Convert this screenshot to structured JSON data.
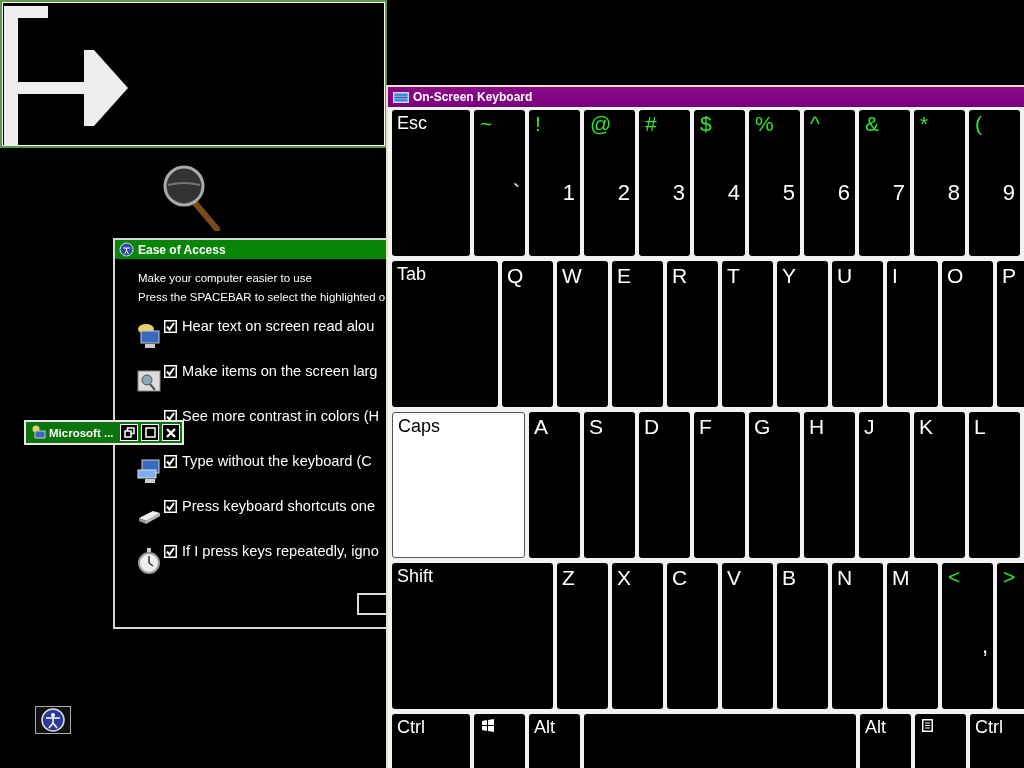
{
  "ease_of_access": {
    "title": "Ease of Access",
    "intro": "Make your computer easier to use",
    "instruction": "Press the SPACEBAR to select the highlighted o",
    "options": [
      {
        "label": "Hear text on screen read alou",
        "checked": true
      },
      {
        "label": "Make items on the screen larg",
        "checked": true
      },
      {
        "label": "See more contrast in colors (H",
        "checked": true
      },
      {
        "label": "Type without the keyboard (C",
        "checked": true
      },
      {
        "label": "Press keyboard shortcuts one",
        "checked": true
      },
      {
        "label": "If I press keys repeatedly, igno",
        "checked": true
      }
    ]
  },
  "minimized_window": {
    "title": "Microsoft ..."
  },
  "on_screen_keyboard": {
    "title": "On-Screen Keyboard",
    "key_rows": [
      {
        "keys": [
          {
            "kind": "wide",
            "label": "Esc",
            "highlighted": false
          },
          {
            "kind": "dual",
            "shift": "~",
            "label": "`",
            "highlighted": false
          },
          {
            "kind": "dual",
            "shift": "!",
            "label": "1",
            "highlighted": false
          },
          {
            "kind": "dual",
            "shift": "@",
            "label": "2",
            "highlighted": false
          },
          {
            "kind": "dual",
            "shift": "#",
            "label": "3",
            "highlighted": false
          },
          {
            "kind": "dual",
            "shift": "$",
            "label": "4",
            "highlighted": false
          },
          {
            "kind": "dual",
            "shift": "%",
            "label": "5",
            "highlighted": false
          },
          {
            "kind": "dual",
            "shift": "^",
            "label": "6",
            "highlighted": false
          },
          {
            "kind": "dual",
            "shift": "&",
            "label": "7",
            "highlighted": false
          },
          {
            "kind": "dual",
            "shift": "*",
            "label": "8",
            "highlighted": false
          },
          {
            "kind": "dual",
            "shift": "(",
            "label": "9",
            "highlighted": false
          }
        ]
      },
      {
        "keys": [
          {
            "kind": "tab",
            "label": "Tab",
            "highlighted": false
          },
          {
            "kind": "key",
            "label": "Q",
            "highlighted": false
          },
          {
            "kind": "key",
            "label": "W",
            "highlighted": false
          },
          {
            "kind": "key",
            "label": "E",
            "highlighted": false
          },
          {
            "kind": "key",
            "label": "R",
            "highlighted": false
          },
          {
            "kind": "key",
            "label": "T",
            "highlighted": false
          },
          {
            "kind": "key",
            "label": "Y",
            "highlighted": false
          },
          {
            "kind": "key",
            "label": "U",
            "highlighted": false
          },
          {
            "kind": "key",
            "label": "I",
            "highlighted": false
          },
          {
            "kind": "key",
            "label": "O",
            "highlighted": false
          },
          {
            "kind": "key",
            "label": "P",
            "highlighted": false
          }
        ]
      },
      {
        "keys": [
          {
            "kind": "caps",
            "label": "Caps",
            "highlighted": true
          },
          {
            "kind": "key",
            "label": "A",
            "highlighted": false
          },
          {
            "kind": "key",
            "label": "S",
            "highlighted": false
          },
          {
            "kind": "key",
            "label": "D",
            "highlighted": false
          },
          {
            "kind": "key",
            "label": "F",
            "highlighted": false
          },
          {
            "kind": "key",
            "label": "G",
            "highlighted": false
          },
          {
            "kind": "key",
            "label": "H",
            "highlighted": false
          },
          {
            "kind": "key",
            "label": "J",
            "highlighted": false
          },
          {
            "kind": "key",
            "label": "K",
            "highlighted": false
          },
          {
            "kind": "key",
            "label": "L",
            "highlighted": false
          }
        ]
      },
      {
        "keys": [
          {
            "kind": "shift",
            "label": "Shift",
            "highlighted": false
          },
          {
            "kind": "key",
            "label": "Z",
            "highlighted": false
          },
          {
            "kind": "key",
            "label": "X",
            "highlighted": false
          },
          {
            "kind": "key",
            "label": "C",
            "highlighted": false
          },
          {
            "kind": "key",
            "label": "V",
            "highlighted": false
          },
          {
            "kind": "key",
            "label": "B",
            "highlighted": false
          },
          {
            "kind": "key",
            "label": "N",
            "highlighted": false
          },
          {
            "kind": "key",
            "label": "M",
            "highlighted": false
          },
          {
            "kind": "dual",
            "shift": "<",
            "label": ",",
            "highlighted": false
          },
          {
            "kind": "shiftonly",
            "shift": ">",
            "highlighted": false
          }
        ]
      },
      {
        "keys": [
          {
            "kind": "wide",
            "label": "Ctrl",
            "highlighted": false
          },
          {
            "kind": "win",
            "highlighted": false
          },
          {
            "kind": "key",
            "label": "Alt",
            "highlighted": false
          },
          {
            "kind": "space",
            "highlighted": false
          },
          {
            "kind": "key",
            "label": "Alt",
            "highlighted": false
          },
          {
            "kind": "menu",
            "highlighted": false
          },
          {
            "kind": "wide",
            "label": "Ctrl",
            "highlighted": false
          }
        ]
      }
    ]
  }
}
